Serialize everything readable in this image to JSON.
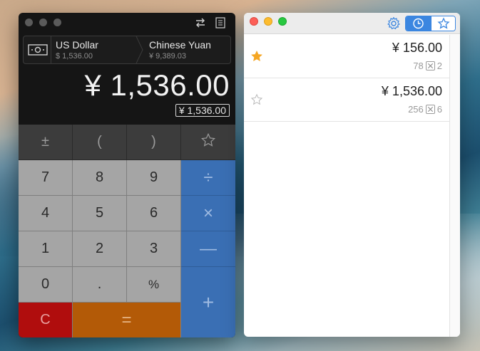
{
  "calculator": {
    "currency_from": {
      "name": "US Dollar",
      "amount": "$ 1,536.00"
    },
    "currency_to": {
      "name": "Chinese Yuan",
      "amount": "¥ 9,389.03"
    },
    "display_main": "¥ 1,536.00",
    "display_sub": "¥ 1,536.00",
    "keys": {
      "plus_minus": "±",
      "paren_open": "(",
      "paren_close": ")",
      "seven": "7",
      "eight": "8",
      "nine": "9",
      "divide": "÷",
      "four": "4",
      "five": "5",
      "six": "6",
      "multiply": "×",
      "one": "1",
      "two": "2",
      "three": "3",
      "minus": "—",
      "zero": "0",
      "dot": ".",
      "percent": "%",
      "plus": "+",
      "clear": "C",
      "equals": "="
    }
  },
  "history": {
    "items": [
      {
        "value": "¥ 156.00",
        "expr_left": "78",
        "expr_right": "2",
        "starred": true
      },
      {
        "value": "¥ 1,536.00",
        "expr_left": "256",
        "expr_right": "6",
        "starred": false
      }
    ]
  },
  "colors": {
    "accent": "#3b86e0",
    "operator_key": "#3a6fb4",
    "clear_key": "#b00d0d",
    "equals_key": "#b35a07",
    "star_filled": "#f5a623"
  }
}
